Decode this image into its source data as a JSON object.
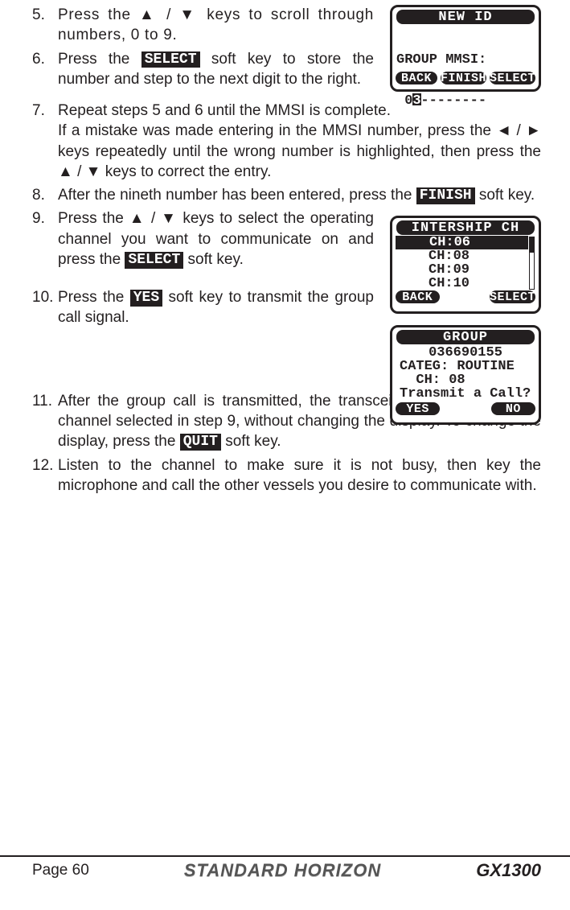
{
  "steps": {
    "s5": {
      "num": "5.",
      "text": "Press the ▲ / ▼ keys to scroll through numbers, 0 to 9."
    },
    "s6": {
      "num": "6.",
      "t1": "Press the ",
      "k1": "SELECT",
      "t2": " soft key to store the number and step to the next digit to the right."
    },
    "s7": {
      "num": "7.",
      "t1": "Repeat steps 5 and 6 until the MMSI is complete.",
      "t2a": "If a mistake was made entering in the MMSI number, press the ",
      "t2b": " / ",
      "t2c": " keys repeatedly until the wrong number is highlighted, then press the ▲ / ▼ keys to correct the entry."
    },
    "s8": {
      "num": "8.",
      "t1": "After the nineth number has been entered, press the ",
      "k1": "FINISH",
      "t2": " soft key."
    },
    "s9": {
      "num": "9.",
      "t1": "Press the ▲ / ▼ keys to select the operating channel you want to communicate on and press the ",
      "k1": "SELECT",
      "t2": " soft key."
    },
    "s10": {
      "num": "10.",
      "t1": "Press the ",
      "k1": "YES",
      "t2": " soft key to transmit the group call signal."
    },
    "s11": {
      "num": "11.",
      "t1": "After the group call is transmitted, the transceiver will switch to the channel selected in step 9, without changing the display. To change the display, press the ",
      "k1": "QUIT",
      "t2": " soft key."
    },
    "s12": {
      "num": "12.",
      "t1": "Listen to the channel to make sure it is not busy, then key the microphone and call the other vessels you desire to communicate with."
    }
  },
  "arrows": {
    "left": "◄",
    "right": "►"
  },
  "lcd1": {
    "title": "NEW ID",
    "label": "GROUP MMSI:",
    "prefix": " 0",
    "cursor": "3",
    "suffix": "--------",
    "sk1": "BACK",
    "sk2": "FINISH",
    "sk3": "SELECT"
  },
  "lcd2": {
    "title": "INTERSHIP CH",
    "items": [
      "CH:06",
      "CH:08",
      "CH:09",
      "CH:10"
    ],
    "sk1": "BACK",
    "sk2": "SELECT"
  },
  "lcd3": {
    "title": "GROUP",
    "l1": "036690155",
    "l2": "CATEG: ROUTINE",
    "l3": "  CH: 08",
    "l4": "Transmit a Call?",
    "sk1": "YES",
    "sk2": "NO"
  },
  "footer": {
    "page": "Page 60",
    "brand": "STANDARD HORIZON",
    "model": "GX1300"
  }
}
